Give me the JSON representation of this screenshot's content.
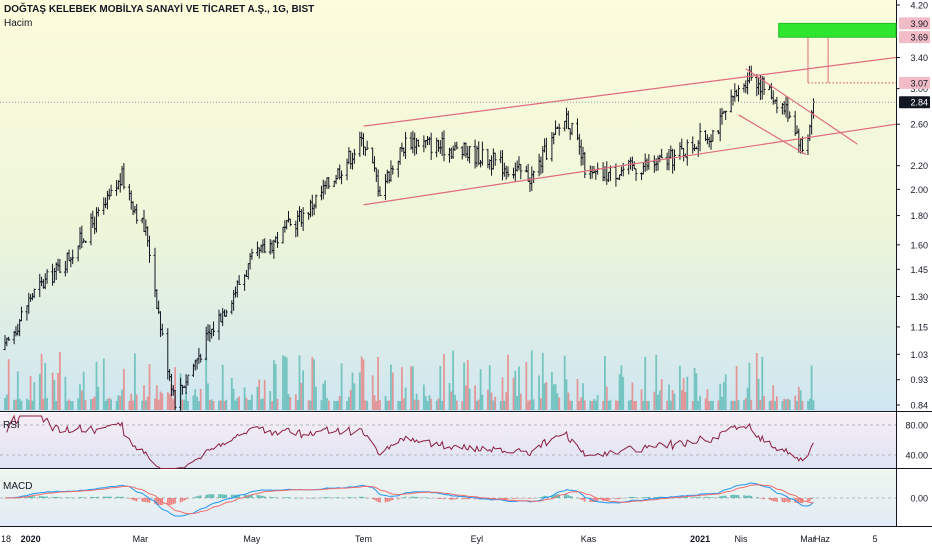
{
  "header": {
    "symbol_title": "DOĞTAŞ KELEBEK MOBİLYA SANAYİ VE TİCARET A.Ş., 1G, BIST",
    "volume_label": "Hacim"
  },
  "colors": {
    "up": "#26a69a",
    "down": "#ef5350",
    "wick": "#131722",
    "channel": "#e06b7f",
    "target_box": "#2ee62e",
    "rsi_line": "#8b1e3f",
    "macd_line": "#2196f3",
    "signal_line": "#ef6c6c",
    "price_badge": "#131722",
    "target_badge": "#f2bcc6"
  },
  "price_axis": {
    "ticks": [
      "4.20",
      "3.40",
      "3.00",
      "2.60",
      "2.20",
      "2.00",
      "1.80",
      "1.60",
      "1.45",
      "1.30",
      "1.15",
      "1.03",
      "0.93",
      "0.84"
    ],
    "badges": [
      {
        "label": "3.90",
        "kind": "target"
      },
      {
        "label": "3.69",
        "kind": "target"
      },
      {
        "label": "3.07",
        "kind": "target"
      },
      {
        "label": "2.84",
        "kind": "current"
      }
    ]
  },
  "rsi": {
    "label": "RSI",
    "ticks": [
      "80.00",
      "40.00"
    ]
  },
  "macd": {
    "label": "MACD",
    "ticks": [
      "0.00"
    ]
  },
  "time_axis": {
    "labels": [
      "18",
      "2020",
      "Mar",
      "May",
      "Tem",
      "Eyl",
      "Kas",
      "2021",
      "Mar",
      "Nis",
      "Haz",
      "5"
    ]
  },
  "chart_data": {
    "type": "candlestick",
    "title": "DOĞTAŞ KELEBEK MOBİLYA SANAYİ VE TİCARET A.Ş., 1G, BIST",
    "xlabel": "",
    "ylabel": "",
    "scale": "log",
    "ylim": [
      0.84,
      4.2
    ],
    "current_price": 2.84,
    "targets": [
      3.07,
      3.69,
      3.9
    ],
    "close_path": [
      {
        "date": "2019-12-18",
        "close": 1.05
      },
      {
        "date": "2020-01-01",
        "close": 1.3
      },
      {
        "date": "2020-01-20",
        "close": 1.5
      },
      {
        "date": "2020-02-10",
        "close": 1.85
      },
      {
        "date": "2020-02-20",
        "close": 2.1
      },
      {
        "date": "2020-03-05",
        "close": 1.65
      },
      {
        "date": "2020-03-13",
        "close": 1.1
      },
      {
        "date": "2020-03-20",
        "close": 0.86
      },
      {
        "date": "2020-04-10",
        "close": 1.15
      },
      {
        "date": "2020-05-01",
        "close": 1.5
      },
      {
        "date": "2020-06-01",
        "close": 1.85
      },
      {
        "date": "2020-07-01",
        "close": 2.45
      },
      {
        "date": "2020-07-10",
        "close": 2.0
      },
      {
        "date": "2020-07-25",
        "close": 2.45
      },
      {
        "date": "2020-09-01",
        "close": 2.3
      },
      {
        "date": "2020-10-01",
        "close": 2.1
      },
      {
        "date": "2020-10-20",
        "close": 2.7
      },
      {
        "date": "2020-11-01",
        "close": 2.1
      },
      {
        "date": "2020-12-15",
        "close": 2.25
      },
      {
        "date": "2021-01-10",
        "close": 2.55
      },
      {
        "date": "2021-01-28",
        "close": 3.2
      },
      {
        "date": "2021-02-20",
        "close": 2.7
      },
      {
        "date": "2021-02-27",
        "close": 2.3
      },
      {
        "date": "2021-03-04",
        "close": 2.84
      }
    ],
    "rsi_range": [
      40,
      80
    ],
    "macd_zero": 0.0
  }
}
